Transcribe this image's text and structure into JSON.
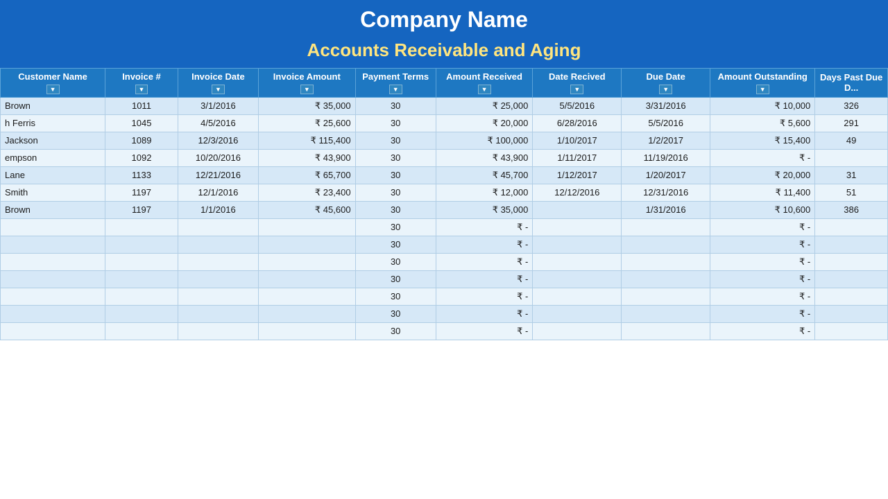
{
  "header": {
    "company_name": "Company Name",
    "subtitle": "Accounts Receivable and Aging"
  },
  "columns": [
    {
      "key": "customer_name",
      "label": "Customer Name",
      "has_dropdown": true
    },
    {
      "key": "invoice_num",
      "label": "Invoice #",
      "has_dropdown": true
    },
    {
      "key": "invoice_date",
      "label": "Invoice Date",
      "has_dropdown": true
    },
    {
      "key": "invoice_amount",
      "label": "Invoice Amount",
      "has_dropdown": true
    },
    {
      "key": "payment_terms",
      "label": "Payment Terms",
      "has_dropdown": true
    },
    {
      "key": "amount_received",
      "label": "Amount Received",
      "has_dropdown": true
    },
    {
      "key": "date_received",
      "label": "Date Recived",
      "has_dropdown": true
    },
    {
      "key": "due_date",
      "label": "Due Date",
      "has_dropdown": true
    },
    {
      "key": "amount_outstanding",
      "label": "Amount Outstanding",
      "has_dropdown": true
    },
    {
      "key": "days_past_due",
      "label": "Days Past Due D...",
      "has_dropdown": false
    }
  ],
  "rows": [
    {
      "customer_name": "Brown",
      "invoice_num": "1011",
      "invoice_date": "3/1/2016",
      "invoice_amount": "₹   35,000",
      "payment_terms": "30",
      "amount_received": "₹   25,000",
      "date_received": "5/5/2016",
      "due_date": "3/31/2016",
      "amount_outstanding": "₹   10,000",
      "days_past_due": "326"
    },
    {
      "customer_name": "h Ferris",
      "invoice_num": "1045",
      "invoice_date": "4/5/2016",
      "invoice_amount": "₹   25,600",
      "payment_terms": "30",
      "amount_received": "₹   20,000",
      "date_received": "6/28/2016",
      "due_date": "5/5/2016",
      "amount_outstanding": "₹     5,600",
      "days_past_due": "291"
    },
    {
      "customer_name": "Jackson",
      "invoice_num": "1089",
      "invoice_date": "12/3/2016",
      "invoice_amount": "₹ 115,400",
      "payment_terms": "30",
      "amount_received": "₹ 100,000",
      "date_received": "1/10/2017",
      "due_date": "1/2/2017",
      "amount_outstanding": "₹   15,400",
      "days_past_due": "49"
    },
    {
      "customer_name": "empson",
      "invoice_num": "1092",
      "invoice_date": "10/20/2016",
      "invoice_amount": "₹   43,900",
      "payment_terms": "30",
      "amount_received": "₹   43,900",
      "date_received": "1/11/2017",
      "due_date": "11/19/2016",
      "amount_outstanding": "₹          -",
      "days_past_due": ""
    },
    {
      "customer_name": "Lane",
      "invoice_num": "1133",
      "invoice_date": "12/21/2016",
      "invoice_amount": "₹   65,700",
      "payment_terms": "30",
      "amount_received": "₹   45,700",
      "date_received": "1/12/2017",
      "due_date": "1/20/2017",
      "amount_outstanding": "₹   20,000",
      "days_past_due": "31"
    },
    {
      "customer_name": "Smith",
      "invoice_num": "1197",
      "invoice_date": "12/1/2016",
      "invoice_amount": "₹   23,400",
      "payment_terms": "30",
      "amount_received": "₹   12,000",
      "date_received": "12/12/2016",
      "due_date": "12/31/2016",
      "amount_outstanding": "₹   11,400",
      "days_past_due": "51"
    },
    {
      "customer_name": "Brown",
      "invoice_num": "1197",
      "invoice_date": "1/1/2016",
      "invoice_amount": "₹   45,600",
      "payment_terms": "30",
      "amount_received": "₹   35,000",
      "date_received": "",
      "due_date": "1/31/2016",
      "amount_outstanding": "₹   10,600",
      "days_past_due": "386"
    },
    {
      "customer_name": "",
      "invoice_num": "",
      "invoice_date": "",
      "invoice_amount": "",
      "payment_terms": "30",
      "amount_received": "₹          -",
      "date_received": "",
      "due_date": "",
      "amount_outstanding": "₹          -",
      "days_past_due": ""
    },
    {
      "customer_name": "",
      "invoice_num": "",
      "invoice_date": "",
      "invoice_amount": "",
      "payment_terms": "30",
      "amount_received": "₹          -",
      "date_received": "",
      "due_date": "",
      "amount_outstanding": "₹          -",
      "days_past_due": ""
    },
    {
      "customer_name": "",
      "invoice_num": "",
      "invoice_date": "",
      "invoice_amount": "",
      "payment_terms": "30",
      "amount_received": "₹          -",
      "date_received": "",
      "due_date": "",
      "amount_outstanding": "₹          -",
      "days_past_due": ""
    },
    {
      "customer_name": "",
      "invoice_num": "",
      "invoice_date": "",
      "invoice_amount": "",
      "payment_terms": "30",
      "amount_received": "₹          -",
      "date_received": "",
      "due_date": "",
      "amount_outstanding": "₹          -",
      "days_past_due": ""
    },
    {
      "customer_name": "",
      "invoice_num": "",
      "invoice_date": "",
      "invoice_amount": "",
      "payment_terms": "30",
      "amount_received": "₹          -",
      "date_received": "",
      "due_date": "",
      "amount_outstanding": "₹          -",
      "days_past_due": ""
    },
    {
      "customer_name": "",
      "invoice_num": "",
      "invoice_date": "",
      "invoice_amount": "",
      "payment_terms": "30",
      "amount_received": "₹          -",
      "date_received": "",
      "due_date": "",
      "amount_outstanding": "₹          -",
      "days_past_due": ""
    },
    {
      "customer_name": "",
      "invoice_num": "",
      "invoice_date": "",
      "invoice_amount": "",
      "payment_terms": "30",
      "amount_received": "₹          -",
      "date_received": "",
      "due_date": "",
      "amount_outstanding": "₹          -",
      "days_past_due": ""
    }
  ]
}
